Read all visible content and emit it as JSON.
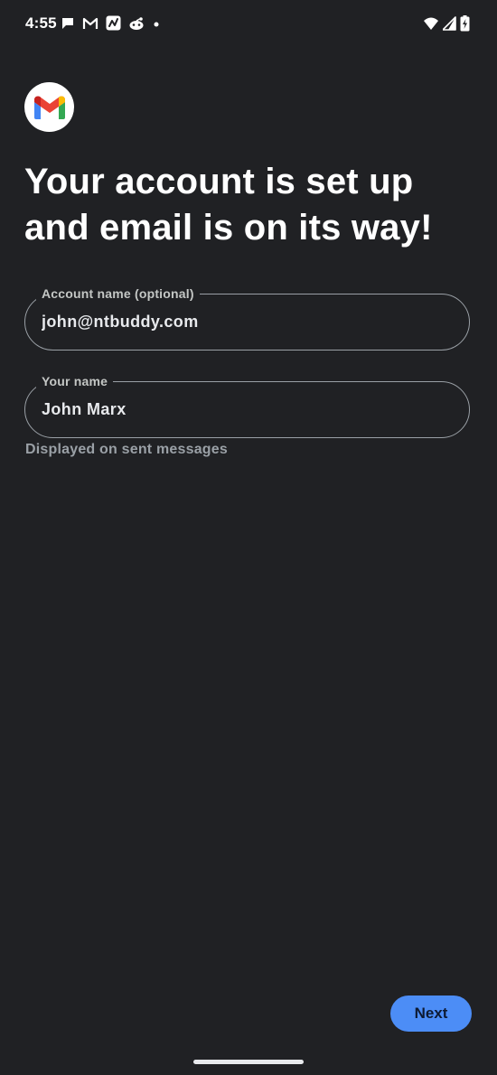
{
  "status_bar": {
    "time": "4:55",
    "notification_icons": [
      "chat-bubble-icon",
      "gmail-icon",
      "news-app-icon",
      "reddit-icon",
      "dot-icon"
    ],
    "system_icons": [
      "wifi-icon",
      "cellular-signal-icon",
      "battery-charging-icon"
    ]
  },
  "app": {
    "name": "Gmail",
    "logo_icon": "gmail-logo-icon",
    "colors": {
      "background": "#202124",
      "accent": "#4c8df6",
      "outline": "#9aa0a6"
    }
  },
  "headline": "Your account is set up and email is on its way!",
  "form": {
    "account_name": {
      "label": "Account name (optional)",
      "value": "john@ntbuddy.com"
    },
    "your_name": {
      "label": "Your name",
      "value": "John Marx",
      "helper": "Displayed on sent messages"
    }
  },
  "actions": {
    "next_label": "Next"
  }
}
